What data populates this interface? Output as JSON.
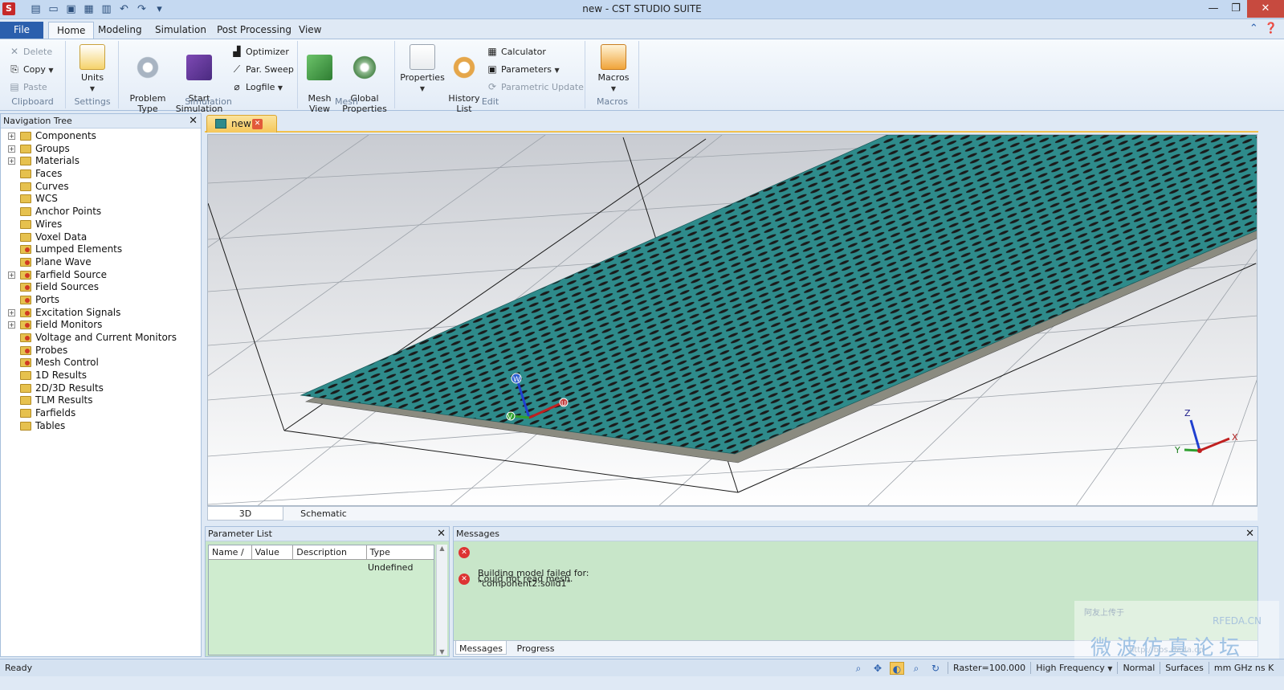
{
  "window": {
    "title": "new - CST STUDIO SUITE",
    "controls": [
      "—",
      "❐",
      "✕"
    ]
  },
  "qat_icons": [
    "new-file-icon",
    "open-folder-icon",
    "save-icon",
    "save-all-icon",
    "print-icon",
    "undo-icon",
    "redo-icon",
    "customize-qat-icon"
  ],
  "ribbon": {
    "tabs": [
      "File",
      "Home",
      "Modeling",
      "Simulation",
      "Post Processing",
      "View"
    ],
    "active_tab": "Home",
    "clipboard": {
      "label": "Clipboard",
      "delete": "Delete",
      "copy": "Copy",
      "paste": "Paste"
    },
    "settings": {
      "label": "Settings",
      "units": "Units"
    },
    "simulation": {
      "label": "Simulation",
      "problem_type": "Problem\nType",
      "start_simulation": "Start\nSimulation",
      "optimizer": "Optimizer",
      "par_sweep": "Par. Sweep",
      "logfile": "Logfile"
    },
    "mesh": {
      "label": "Mesh",
      "mesh_view": "Mesh\nView",
      "global_properties": "Global\nProperties"
    },
    "edit": {
      "label": "Edit",
      "properties": "Properties",
      "history_list": "History\nList",
      "calculator": "Calculator",
      "parameters": "Parameters",
      "parametric_update": "Parametric Update"
    },
    "macros": {
      "label": "Macros",
      "macros": "Macros"
    }
  },
  "navigation_tree": {
    "title": "Navigation Tree",
    "items": [
      {
        "label": "Components",
        "expandable": true,
        "icon": "folder"
      },
      {
        "label": "Groups",
        "expandable": true,
        "icon": "folder"
      },
      {
        "label": "Materials",
        "expandable": true,
        "icon": "folder"
      },
      {
        "label": "Faces",
        "expandable": false,
        "icon": "folder"
      },
      {
        "label": "Curves",
        "expandable": false,
        "icon": "folder"
      },
      {
        "label": "WCS",
        "expandable": false,
        "icon": "folder"
      },
      {
        "label": "Anchor Points",
        "expandable": false,
        "icon": "folder"
      },
      {
        "label": "Wires",
        "expandable": false,
        "icon": "folder"
      },
      {
        "label": "Voxel Data",
        "expandable": false,
        "icon": "folder"
      },
      {
        "label": "Lumped Elements",
        "expandable": false,
        "icon": "folder-red"
      },
      {
        "label": "Plane Wave",
        "expandable": false,
        "icon": "folder-red"
      },
      {
        "label": "Farfield Source",
        "expandable": true,
        "icon": "folder-red"
      },
      {
        "label": "Field Sources",
        "expandable": false,
        "icon": "folder-red"
      },
      {
        "label": "Ports",
        "expandable": false,
        "icon": "folder-red"
      },
      {
        "label": "Excitation Signals",
        "expandable": true,
        "icon": "folder-red"
      },
      {
        "label": "Field Monitors",
        "expandable": true,
        "icon": "folder-red"
      },
      {
        "label": "Voltage and Current Monitors",
        "expandable": false,
        "icon": "folder-red"
      },
      {
        "label": "Probes",
        "expandable": false,
        "icon": "folder-red"
      },
      {
        "label": "Mesh Control",
        "expandable": false,
        "icon": "folder-red"
      },
      {
        "label": "1D Results",
        "expandable": false,
        "icon": "folder"
      },
      {
        "label": "2D/3D Results",
        "expandable": false,
        "icon": "folder"
      },
      {
        "label": "TLM Results",
        "expandable": false,
        "icon": "folder"
      },
      {
        "label": "Farfields",
        "expandable": false,
        "icon": "folder"
      },
      {
        "label": "Tables",
        "expandable": false,
        "icon": "folder"
      }
    ]
  },
  "document": {
    "tab_label": "new",
    "view_tabs": [
      "3D",
      "Schematic"
    ],
    "active_view": "3D",
    "axis_labels": {
      "u": "U",
      "v": "V",
      "w": "W",
      "x": "X",
      "y": "Y",
      "z": "Z"
    }
  },
  "parameter_list": {
    "title": "Parameter List",
    "columns": [
      "Name /",
      "Value",
      "Description",
      "Type"
    ],
    "rows": [
      {
        "type": "Undefined"
      }
    ]
  },
  "messages": {
    "title": "Messages",
    "items": [
      {
        "level": "error",
        "text": "Building model failed for:\n\"component2:solid1\""
      },
      {
        "level": "error",
        "text": "Could not read mesh."
      }
    ],
    "tabs": [
      "Messages",
      "Progress"
    ],
    "active_tab": "Messages"
  },
  "watermark": {
    "small": "阿友上传于",
    "brand": "RFEDA.CN",
    "big": "微波仿真论坛",
    "url": "http://bbs.rfeda.cn"
  },
  "statusbar": {
    "status": "Ready",
    "raster": "Raster=100.000",
    "frequency_mode": "High Frequency",
    "render_mode": "Normal",
    "display_mode": "Surfaces",
    "units": "mm  GHz  ns  K"
  },
  "colors": {
    "accent": "#2b5fad",
    "plate": "#2e8b8b",
    "message_bg": "#c8e6c9",
    "error": "#d33333"
  }
}
